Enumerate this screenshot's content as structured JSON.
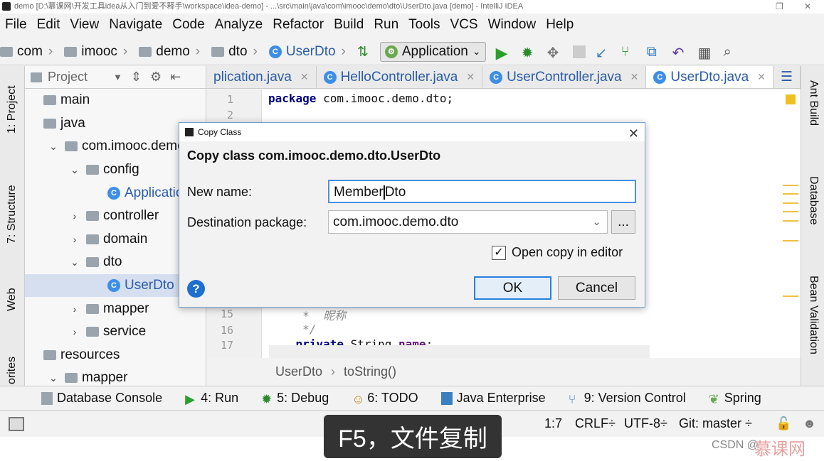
{
  "window": {
    "title": "demo [D:\\慕课网\\开发工具idea从入门到爱不释手\\workspace\\idea-demo] - ...\\src\\main\\java\\com\\imooc\\demo\\dto\\UserDto.java [demo] - IntelliJ IDEA"
  },
  "menu": [
    "File",
    "Edit",
    "View",
    "Navigate",
    "Code",
    "Analyze",
    "Refactor",
    "Build",
    "Run",
    "Tools",
    "VCS",
    "Window",
    "Help"
  ],
  "nav": {
    "crumbs": [
      "com",
      "imooc",
      "demo",
      "dto",
      "UserDto"
    ],
    "run_config": "Application"
  },
  "project_panel": {
    "title": "Project",
    "tree": [
      {
        "label": "main",
        "indent": 0,
        "arrow": ""
      },
      {
        "label": "java",
        "indent": 0,
        "arrow": ""
      },
      {
        "label": "com.imooc.demo",
        "indent": 1,
        "arrow": "⌄"
      },
      {
        "label": "config",
        "indent": 2,
        "arrow": "⌄"
      },
      {
        "label": "Application",
        "indent": 3,
        "arrow": ""
      },
      {
        "label": "controller",
        "indent": 2,
        "arrow": "›"
      },
      {
        "label": "domain",
        "indent": 2,
        "arrow": "›"
      },
      {
        "label": "dto",
        "indent": 2,
        "arrow": "⌄"
      },
      {
        "label": "UserDto",
        "indent": 3,
        "arrow": ""
      },
      {
        "label": "mapper",
        "indent": 2,
        "arrow": "›"
      },
      {
        "label": "service",
        "indent": 2,
        "arrow": "›"
      },
      {
        "label": "resources",
        "indent": 0,
        "arrow": ""
      },
      {
        "label": "mapper",
        "indent": 1,
        "arrow": "⌄"
      }
    ]
  },
  "left_tabs": [
    "1: Project",
    "7: Structure",
    "Web",
    "orites"
  ],
  "right_tabs": [
    "Ant Build",
    "Database",
    "Bean Validation"
  ],
  "tabs": [
    {
      "label": "plication.java",
      "active": false
    },
    {
      "label": "HelloController.java",
      "active": false
    },
    {
      "label": "UserController.java",
      "active": false
    },
    {
      "label": "UserDto.java",
      "active": true
    }
  ],
  "editor": {
    "lines": [
      {
        "n": "1",
        "code": "package com.imooc.demo.dto;"
      },
      {
        "n": "2",
        "code": ""
      },
      {
        "n": "15",
        "code": "     *  昵称"
      },
      {
        "n": "16",
        "code": "     */"
      },
      {
        "n": "17",
        "code": "    private String name;"
      }
    ],
    "breadcrumb": [
      "UserDto",
      "toString()"
    ]
  },
  "dialog": {
    "title": "Copy Class",
    "heading": "Copy class com.imooc.demo.dto.UserDto",
    "new_name_label": "New name:",
    "new_name_value": "MemberDto",
    "dest_label": "Destination package:",
    "dest_value": "com.imooc.demo.dto",
    "browse": "...",
    "open_copy_label": "Open copy in editor",
    "open_copy_checked": true,
    "ok": "OK",
    "cancel": "Cancel",
    "help": "?"
  },
  "bottom_tools": [
    "Database Console",
    "4: Run",
    "5: Debug",
    "6: TODO",
    "Java Enterprise",
    "9: Version Control",
    "Spring"
  ],
  "status": {
    "position": "1:7",
    "line_sep": "CRLF÷",
    "encoding": "UTF-8÷",
    "git": "Git: master ÷"
  },
  "subtitle": "F5，文件复制",
  "watermark": {
    "text": "CSDN @",
    "logo": "慕课网"
  }
}
